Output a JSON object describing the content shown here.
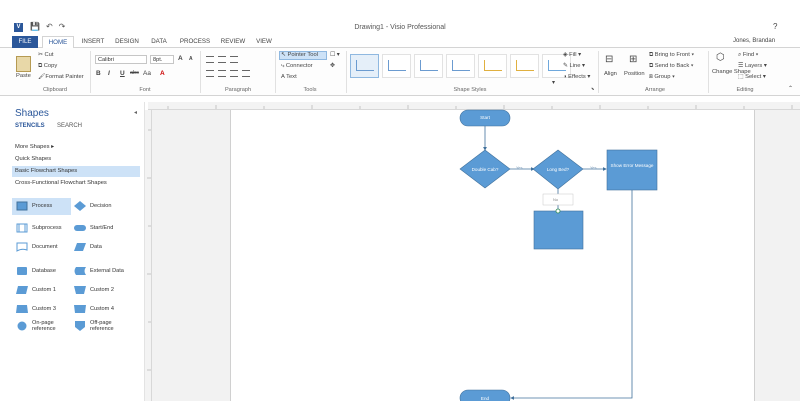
{
  "window": {
    "title": "Drawing1 - Visio Professional",
    "help": "?"
  },
  "app_icon": "V",
  "qat": {
    "save": "💾",
    "undo": "↶",
    "redo": "↷"
  },
  "tabs": [
    {
      "label": "FILE"
    },
    {
      "label": "HOME"
    },
    {
      "label": "INSERT"
    },
    {
      "label": "DESIGN"
    },
    {
      "label": "DATA"
    },
    {
      "label": "PROCESS"
    },
    {
      "label": "REVIEW"
    },
    {
      "label": "VIEW"
    }
  ],
  "user": {
    "name": "Jones, Brandan"
  },
  "ribbon": {
    "clipboard": {
      "paste": "Paste",
      "cut": "Cut",
      "copy": "Copy",
      "format_painter": "Format Painter",
      "label": "Clipboard"
    },
    "font": {
      "family": "Calibri",
      "size": "8pt.",
      "label": "Font",
      "bold": "B",
      "italic": "I",
      "underline": "U",
      "strike": "abc",
      "aa": "Aa",
      "grow": "A",
      "shrink": "A"
    },
    "paragraph": {
      "label": "Paragraph"
    },
    "tools": {
      "pointer": "Pointer Tool",
      "connector": "Connector",
      "text": "Text",
      "label": "Tools"
    },
    "shape_styles": {
      "label": "Shape Styles",
      "colors": [
        "#6b9bd0",
        "#6b9bd0",
        "#6b9bd0",
        "#6b9bd0",
        "#e0b040",
        "#e0b040",
        "#6fa8dc",
        "#6fa8dc"
      ]
    },
    "style_format": {
      "fill": "Fill",
      "line": "Line",
      "effects": "Effects"
    },
    "arrange": {
      "align": "Align",
      "position": "Position",
      "bring_front": "Bring to Front",
      "send_back": "Send to Back",
      "group": "Group",
      "label": "Arrange"
    },
    "editing": {
      "change_shape": "Change Shape",
      "find": "Find",
      "layers": "Layers",
      "select": "Select",
      "label": "Editing"
    }
  },
  "shapes_pane": {
    "title": "Shapes",
    "tabs": [
      "STENCILS",
      "SEARCH"
    ],
    "stencils": [
      {
        "label": "More Shapes  ▸"
      },
      {
        "label": "Quick Shapes"
      },
      {
        "label": "Basic Flowchart Shapes"
      },
      {
        "label": "Cross-Functional Flowchart Shapes"
      }
    ],
    "shapes": [
      {
        "label": "Process",
        "icon": "process-icon"
      },
      {
        "label": "Decision",
        "icon": "decision-icon"
      },
      {
        "label": "Subprocess",
        "icon": "subprocess-icon"
      },
      {
        "label": "Start/End",
        "icon": "start-end-icon"
      },
      {
        "label": "Document",
        "icon": "document-icon"
      },
      {
        "label": "Data",
        "icon": "data-icon"
      },
      {
        "label": "Database",
        "icon": "database-icon"
      },
      {
        "label": "External Data",
        "icon": "external-data-icon"
      },
      {
        "label": "Custom 1",
        "icon": "custom1-icon"
      },
      {
        "label": "Custom 2",
        "icon": "custom2-icon"
      },
      {
        "label": "Custom 3",
        "icon": "custom3-icon"
      },
      {
        "label": "Custom 4",
        "icon": "custom4-icon"
      },
      {
        "label": "On-page reference",
        "icon": "on-page-reference-icon"
      },
      {
        "label": "Off-page reference",
        "icon": "off-page-reference-icon"
      }
    ]
  },
  "diagram": {
    "start": "Start",
    "double_cab": "Double Cab?",
    "long_bed": "Long Bed?",
    "show_error": "Show Error Message",
    "end": "End",
    "yes1": "Yes",
    "yes2": "Yes",
    "no": "No",
    "shape_color": "#5b9bd5",
    "border_color": "#41719c"
  }
}
